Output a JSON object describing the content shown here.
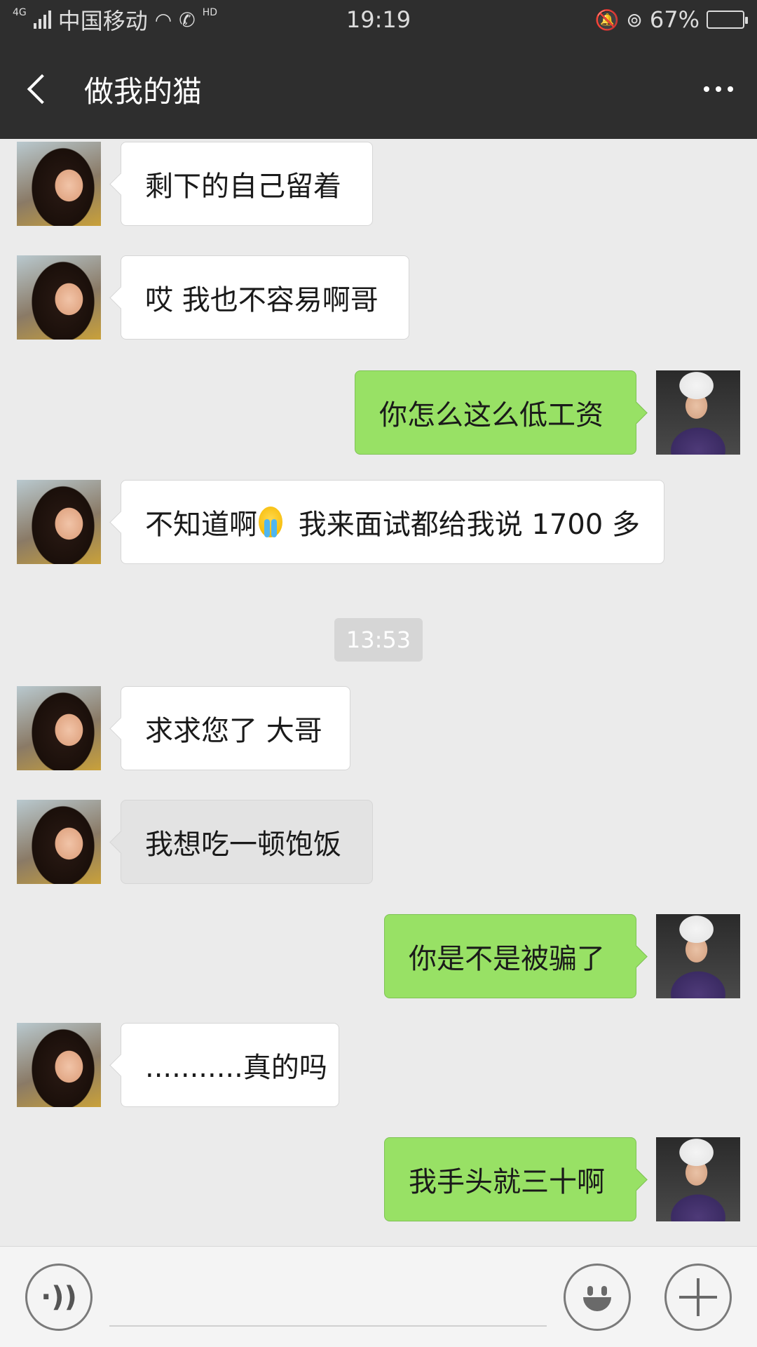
{
  "status_bar": {
    "network_tag": "4G",
    "carrier": "中国移动",
    "hd_tag": "HD",
    "time": "19:19",
    "battery_percent": "67%",
    "battery_level": 0.67
  },
  "header": {
    "title": "做我的猫"
  },
  "messages": [
    {
      "side": "in",
      "text": "剩下的自己留着"
    },
    {
      "side": "in",
      "text": "哎 我也不容易啊哥"
    },
    {
      "side": "out",
      "text": "你怎么这么低工资"
    },
    {
      "side": "in",
      "text_before_emoji": "不知道啊",
      "emoji": "crying-emoji",
      "text_after_emoji": " 我来面试都给我说 1700 多"
    },
    {
      "type": "timestamp",
      "text": "13:53"
    },
    {
      "side": "in",
      "text": "求求您了 大哥"
    },
    {
      "side": "in",
      "text": "我想吃一顿饱饭"
    },
    {
      "side": "out",
      "text": "你是不是被骗了"
    },
    {
      "side": "in",
      "text": "...........真的吗"
    },
    {
      "side": "out",
      "text": "我手头就三十啊"
    }
  ],
  "input_bar": {
    "text_value": "",
    "icons": [
      "voice-icon",
      "emoji-icon",
      "plus-icon"
    ]
  }
}
